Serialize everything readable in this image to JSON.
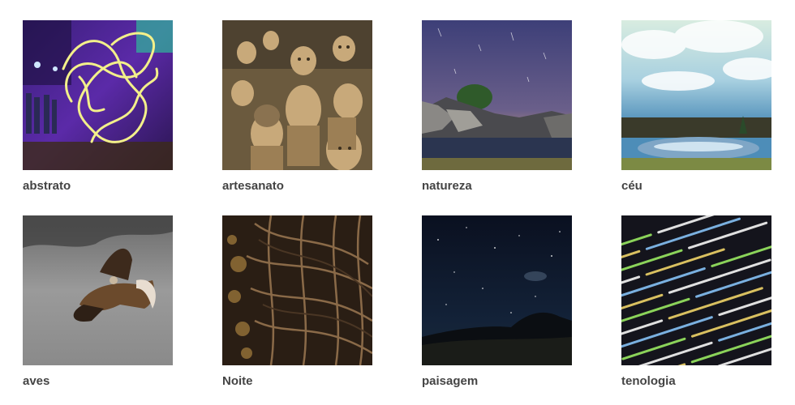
{
  "gallery": {
    "items": [
      {
        "label": "abstrato",
        "image": "light-painting-photo"
      },
      {
        "label": "artesanato",
        "image": "clay-figurines-photo"
      },
      {
        "label": "natureza",
        "image": "night-lake-rocks-photo"
      },
      {
        "label": "céu",
        "image": "sky-lake-park-photo"
      },
      {
        "label": "aves",
        "image": "hawk-in-flight-photo"
      },
      {
        "label": "Noite",
        "image": "woven-branches-bokeh-photo"
      },
      {
        "label": "paisagem",
        "image": "starry-night-landscape-photo"
      },
      {
        "label": "tenologia",
        "image": "source-code-screen-photo"
      }
    ]
  }
}
